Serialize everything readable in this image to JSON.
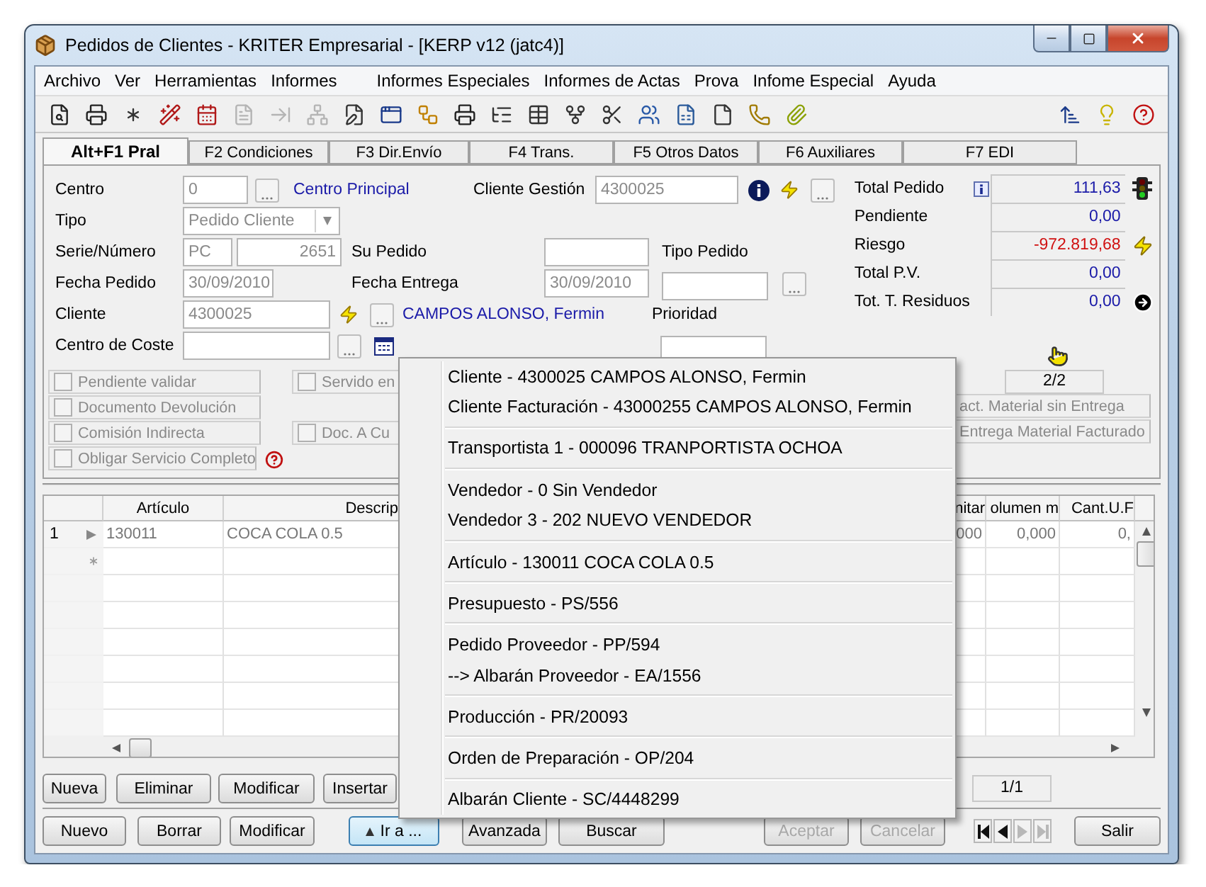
{
  "window": {
    "title": "Pedidos de Clientes - KRITER Empresarial - [KERP v12 (jatc4)]"
  },
  "menu": [
    "Archivo",
    "Ver",
    "Herramientas",
    "Informes",
    "Informes Especiales",
    "Informes de Actas",
    "Prova",
    "Infome Especial",
    "Ayuda"
  ],
  "toolbar": [
    {
      "kind": "preview",
      "disabled": false
    },
    {
      "kind": "print",
      "disabled": false
    },
    {
      "kind": "asterisk",
      "disabled": false
    },
    {
      "kind": "wand",
      "disabled": false
    },
    {
      "kind": "calendar",
      "disabled": false
    },
    {
      "kind": "document",
      "disabled": true
    },
    {
      "kind": "insert",
      "disabled": true
    },
    {
      "kind": "network",
      "disabled": true
    },
    {
      "kind": "edit",
      "disabled": false
    },
    {
      "kind": "window",
      "disabled": false
    },
    {
      "kind": "workflow",
      "disabled": false
    },
    {
      "kind": "print",
      "disabled": false
    },
    {
      "kind": "tree",
      "disabled": false
    },
    {
      "kind": "table",
      "disabled": false
    },
    {
      "kind": "fork",
      "disabled": false
    },
    {
      "kind": "scissors",
      "disabled": false
    },
    {
      "kind": "people",
      "disabled": false
    },
    {
      "kind": "sheet",
      "disabled": false
    },
    {
      "kind": "page",
      "disabled": false
    },
    {
      "kind": "phone",
      "disabled": false
    },
    {
      "kind": "clip",
      "disabled": false
    }
  ],
  "toolbar_right": [
    {
      "kind": "sort",
      "disabled": false
    },
    {
      "kind": "bulb",
      "disabled": false
    },
    {
      "kind": "help",
      "disabled": false
    }
  ],
  "tabs": [
    {
      "label": "Alt+F1 Pral",
      "selected": true
    },
    {
      "label": "F2 Condiciones",
      "selected": false
    },
    {
      "label": "F3 Dir.Envío",
      "selected": false
    },
    {
      "label": "F4 Trans.",
      "selected": false
    },
    {
      "label": "F5 Otros Datos",
      "selected": false
    },
    {
      "label": "F6 Auxiliares",
      "selected": false
    },
    {
      "label": "F7 EDI",
      "selected": false
    }
  ],
  "form": {
    "centro": {
      "label": "Centro",
      "value": "0",
      "name": "Centro Principal"
    },
    "tipo": {
      "label": "Tipo",
      "value": "Pedido Cliente"
    },
    "serie_numero": {
      "label": "Serie/Número",
      "serie": "PC",
      "numero": "2651"
    },
    "fecha_pedido": {
      "label": "Fecha Pedido",
      "value": "30/09/2010"
    },
    "cliente": {
      "label": "Cliente",
      "value": "4300025",
      "name": "CAMPOS ALONSO, Fermin"
    },
    "centro_de_coste": {
      "label": "Centro de Coste"
    },
    "cliente_gestion": {
      "label": "Cliente Gestión",
      "value": "4300025"
    },
    "su_pedido": {
      "label": "Su Pedido"
    },
    "fecha_entrega": {
      "label": "Fecha Entrega",
      "value": "30/09/2010"
    },
    "tipo_pedido": {
      "label": "Tipo Pedido"
    },
    "prioridad": {
      "label": "Prioridad"
    }
  },
  "totals": [
    {
      "label": "Total Pedido",
      "value": "111,63",
      "kind": "traffic",
      "color": "#1a1aa8"
    },
    {
      "label": "Pendiente",
      "value": "0,00",
      "kind": "plain",
      "color": "#1a1aa8"
    },
    {
      "label": "Riesgo",
      "value": "-972.819,68",
      "kind": "risk",
      "color": "#d01010"
    },
    {
      "label": "Total P.V.",
      "value": "0,00",
      "kind": "plain",
      "color": "#1a1aa8"
    },
    {
      "label": "Tot. T. Residuos",
      "value": "0,00",
      "kind": "link",
      "color": "#1a1aa8"
    }
  ],
  "flags": {
    "left": [
      {
        "label": "Pendiente validar",
        "checked": false
      },
      {
        "label": "Documento Devolución",
        "checked": false
      },
      {
        "label": "Comisión Indirecta",
        "checked": false
      },
      {
        "label": "Obligar Servicio Completo",
        "checked": false
      }
    ],
    "middle": [
      {
        "label": "Servido en",
        "checked": false
      },
      {
        "label": "Doc. A Cu",
        "checked": false
      }
    ],
    "right": [
      "act. Material sin Entrega",
      "Entrega Material Facturado"
    ]
  },
  "page_counter": "2/2",
  "table": {
    "columns": [
      "Artículo",
      "Descrip",
      "nitar",
      "olumen m",
      "Cant.U.F"
    ],
    "rows": [
      {
        "number": "1",
        "selected": true,
        "cells": [
          "130011",
          "COCA COLA 0.5",
          "000",
          "0,000",
          "0,"
        ]
      }
    ]
  },
  "line_buttons": [
    "Nueva",
    "Eliminar",
    "Modificar",
    "Insertar"
  ],
  "record_counter": "1/1",
  "buttons": [
    {
      "label": "Nuevo",
      "disabled": false,
      "pressed": false
    },
    {
      "label": "Borrar",
      "disabled": false,
      "pressed": false
    },
    {
      "label": "Modificar",
      "disabled": false,
      "pressed": false
    },
    {
      "label": "Ir a ...",
      "disabled": false,
      "pressed": true
    },
    {
      "label": "Avanzada",
      "disabled": false,
      "pressed": false
    },
    {
      "label": "Buscar",
      "disabled": false,
      "pressed": false
    },
    {
      "label": "Aceptar",
      "disabled": true,
      "pressed": false
    },
    {
      "label": "Cancelar",
      "disabled": true,
      "pressed": false
    }
  ],
  "navigation": [
    {
      "kind": "first",
      "disabled": false
    },
    {
      "kind": "previous",
      "disabled": false
    },
    {
      "kind": "next",
      "disabled": true
    },
    {
      "kind": "last",
      "disabled": true
    }
  ],
  "exit_button": "Salir",
  "popup_menu": {
    "groups": [
      [
        "Cliente - 4300025 CAMPOS ALONSO, Fermin",
        "Cliente Facturación - 43000255 CAMPOS ALONSO, Fermin"
      ],
      [
        "Transportista 1 - 000096 TRANPORTISTA OCHOA"
      ],
      [
        "Vendedor - 0 Sin Vendedor",
        "Vendedor 3 - 202 NUEVO VENDEDOR"
      ],
      [
        "Artículo - 130011 COCA COLA 0.5"
      ],
      [
        "Presupuesto - PS/556"
      ],
      [
        "Pedido Proveedor - PP/594",
        "--> Albarán Proveedor - EA/1556"
      ],
      [
        "Producción - PR/20093"
      ],
      [
        "Orden de Preparación - OP/204"
      ],
      [
        "Albarán Cliente - SC/4448299"
      ]
    ]
  }
}
